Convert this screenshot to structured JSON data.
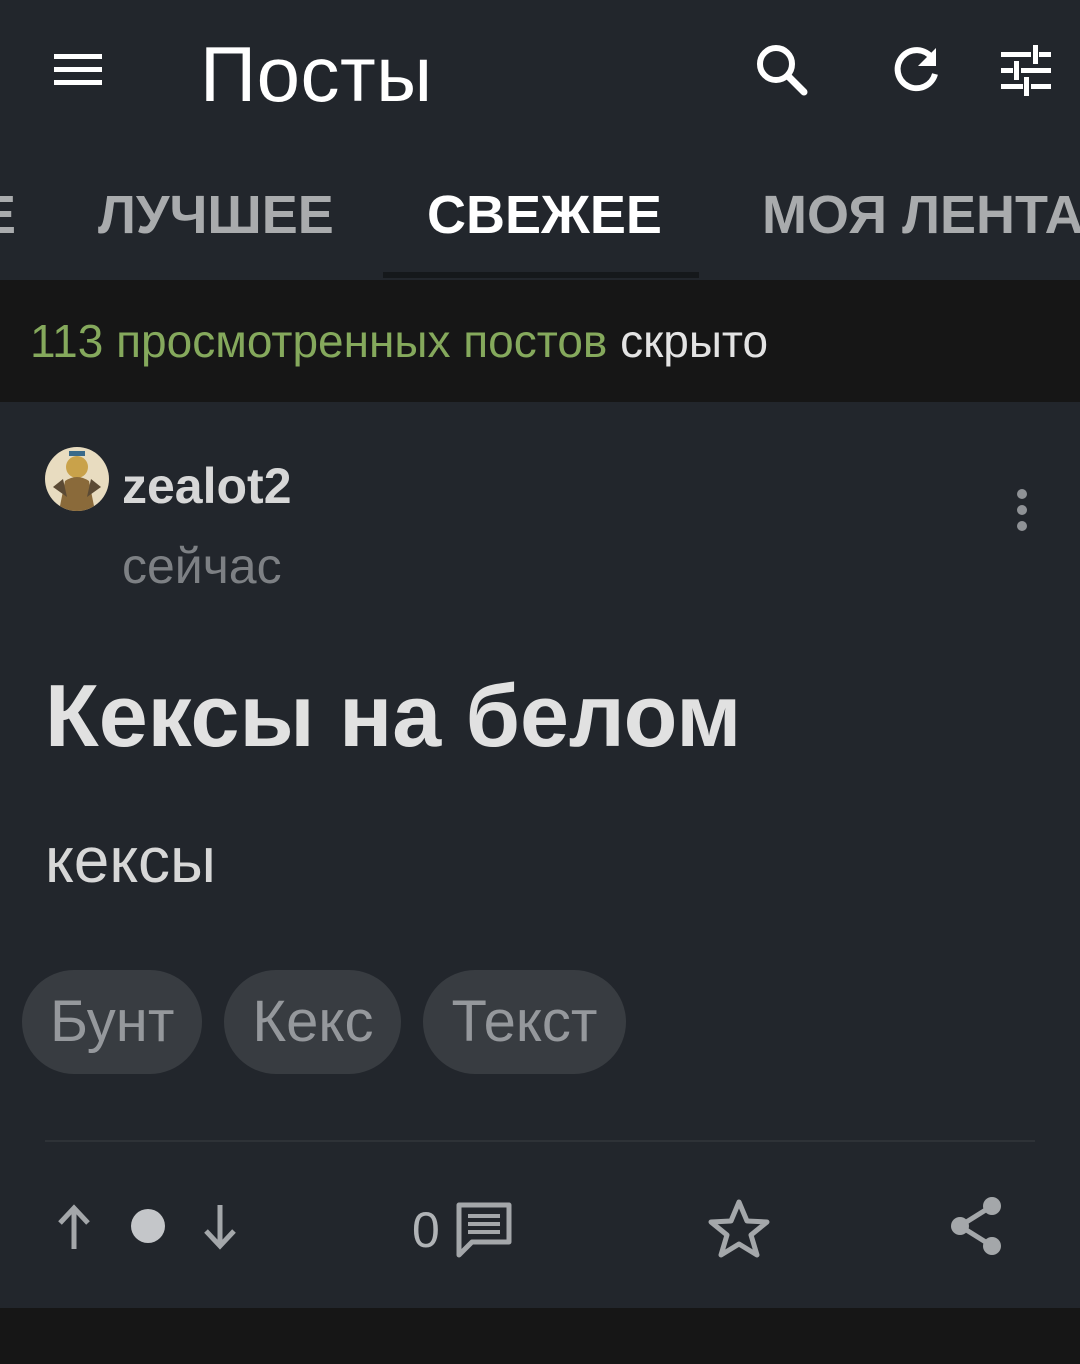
{
  "header": {
    "title": "Посты",
    "menu_icon": "hamburger-menu-icon",
    "search_icon": "search-icon",
    "refresh_icon": "refresh-icon",
    "filter_icon": "sliders-icon"
  },
  "tabs": [
    {
      "label": "Е",
      "active": false
    },
    {
      "label": "ЛУЧШЕЕ",
      "active": false
    },
    {
      "label": "СВЕЖЕЕ",
      "active": true
    },
    {
      "label": "МОЯ ЛЕНТА",
      "active": false
    }
  ],
  "hidden_notice": {
    "count_text": "113 просмотренных постов",
    "status_text": "скрыто"
  },
  "post": {
    "author": "zealot2",
    "time": "сейчас",
    "title": "Кексы на белом",
    "body": "кексы",
    "tags": [
      "Бунт",
      "Кекс",
      "Текст"
    ],
    "comments_count": "0",
    "more_icon": "more-vertical-icon"
  },
  "actions": {
    "upvote_icon": "arrow-up-icon",
    "rating_dot_icon": "rating-dot-icon",
    "downvote_icon": "arrow-down-icon",
    "comments_icon": "comments-icon",
    "save_icon": "star-icon",
    "share_icon": "share-icon"
  },
  "colors": {
    "background": "#161616",
    "surface": "#22262c",
    "accent_green": "#85a95c",
    "tag_background": "#383c41"
  }
}
